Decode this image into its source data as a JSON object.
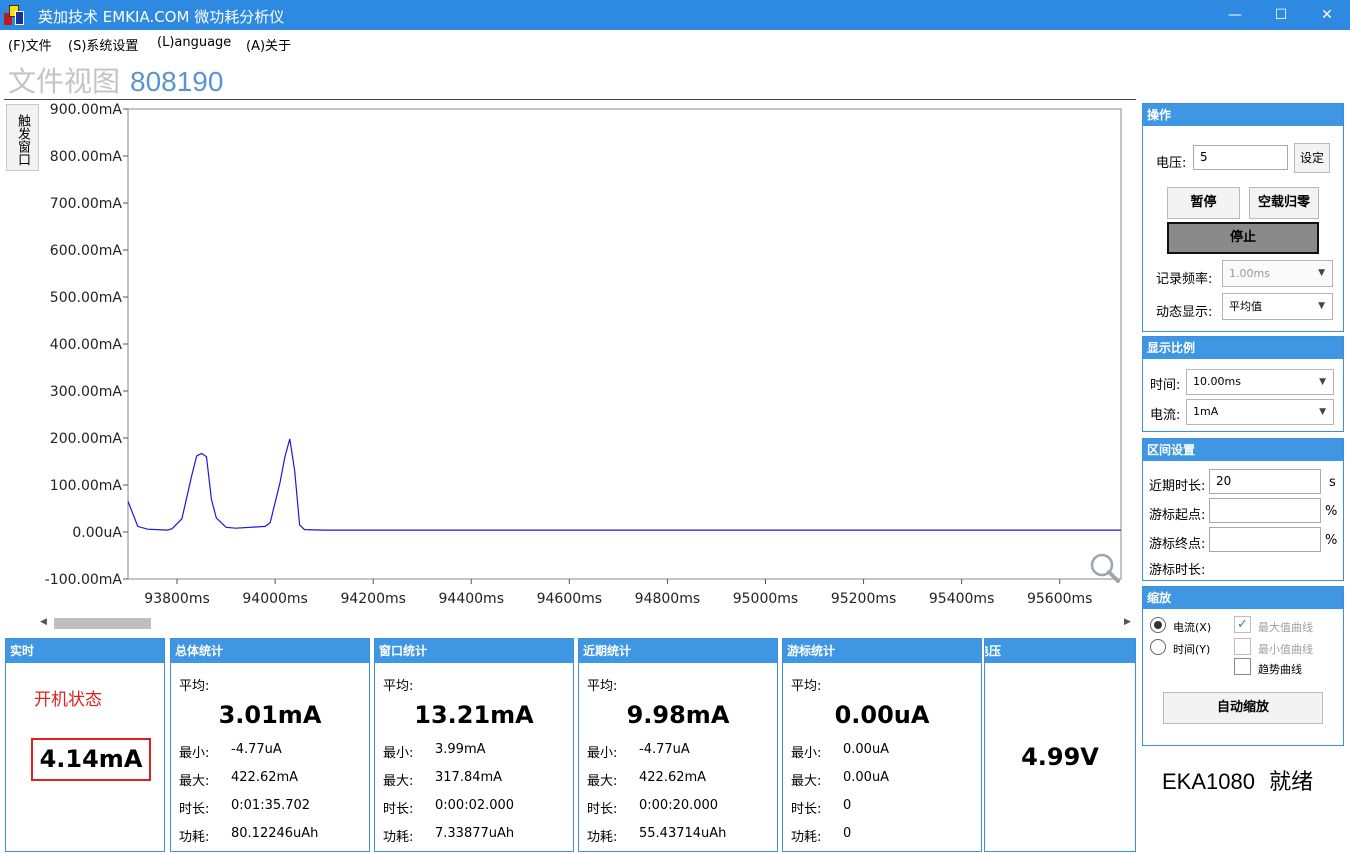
{
  "window": {
    "title": "英加技术 EMKIA.COM 微功耗分析仪",
    "minimize_glyph": "—",
    "maximize_glyph": "☐",
    "close_glyph": "✕",
    "icon": "app-logo-icon",
    "titlebar_color": "#2e8ae0"
  },
  "menu": {
    "file": "(F)文件",
    "settings": "(S)系统设置",
    "language": "(L)anguage",
    "about": "(A)关于"
  },
  "view": {
    "title": "文件视图",
    "number": "808190"
  },
  "trigger_tab": "触发窗口",
  "chart_data": {
    "type": "line",
    "title": "",
    "xlabel": "",
    "ylabel": "",
    "x_unit": "ms",
    "y_unit": "mA",
    "xlim": [
      93700,
      95725
    ],
    "ylim": [
      -100,
      900
    ],
    "yticks": [
      -100,
      0,
      100,
      200,
      300,
      400,
      500,
      600,
      700,
      800,
      900
    ],
    "ytick_labels": [
      "-100.00mA",
      "0.00uA",
      "100.00mA",
      "200.00mA",
      "300.00mA",
      "400.00mA",
      "500.00mA",
      "600.00mA",
      "700.00mA",
      "800.00mA",
      "900.00mA"
    ],
    "xticks": [
      93800,
      94000,
      94200,
      94400,
      94600,
      94800,
      95000,
      95200,
      95400,
      95600
    ],
    "xtick_labels": [
      "93800ms",
      "94000ms",
      "94200ms",
      "94400ms",
      "94600ms",
      "94800ms",
      "95000ms",
      "95200ms",
      "95400ms",
      "95600ms"
    ],
    "grid": false,
    "line_color": "#1a1ad6",
    "series": [
      {
        "x": [
          93700,
          93720,
          93740,
          93780,
          93790,
          93810,
          93830,
          93840,
          93850,
          93860,
          93870,
          93880,
          93900,
          93920,
          93980,
          93990,
          94010,
          94020,
          94030,
          94040,
          94050,
          94060,
          94100,
          95725
        ],
        "y": [
          65,
          12,
          6,
          4,
          7,
          28,
          120,
          162,
          167,
          160,
          70,
          30,
          10,
          8,
          12,
          20,
          105,
          160,
          198,
          130,
          15,
          5,
          4,
          4
        ]
      }
    ]
  },
  "stats": {
    "realtime": {
      "header": "实时",
      "state": "开机状态",
      "value": "4.14mA",
      "state_color": "#e02020"
    },
    "total": {
      "header": "总体统计",
      "avg_label": "平均:",
      "avg": "3.01mA",
      "min_label": "最小:",
      "min": "-4.77uA",
      "max_label": "最大:",
      "max": "422.62mA",
      "dur_label": "时长:",
      "dur": "0:01:35.702",
      "energy_label": "功耗:",
      "energy": "80.12246uAh"
    },
    "window": {
      "header": "窗口统计",
      "avg_label": "平均:",
      "avg": "13.21mA",
      "min_label": "最小:",
      "min": "3.99mA",
      "max_label": "最大:",
      "max": "317.84mA",
      "dur_label": "时长:",
      "dur": "0:00:02.000",
      "energy_label": "功耗:",
      "energy": "7.33877uAh"
    },
    "recent": {
      "header": "近期统计",
      "avg_label": "平均:",
      "avg": "9.98mA",
      "min_label": "最小:",
      "min": "-4.77uA",
      "max_label": "最大:",
      "max": "422.62mA",
      "dur_label": "时长:",
      "dur": "0:00:20.000",
      "energy_label": "功耗:",
      "energy": "55.43714uAh"
    },
    "cursor": {
      "header": "游标统计",
      "avg_label": "平均:",
      "avg": "0.00uA",
      "min_label": "最小:",
      "min": "0.00uA",
      "max_label": "最大:",
      "max": "0.00uA",
      "dur_label": "时长:",
      "dur": "0",
      "energy_label": "功耗:",
      "energy": "0"
    },
    "voltage": {
      "header": "电压",
      "value": "4.99V"
    }
  },
  "ops": {
    "header": "操作",
    "voltage_label": "电压:",
    "voltage_value": "5",
    "set_button": "设定",
    "pause_button": "暂停",
    "zero_button": "空载归零",
    "stop_button": "停止",
    "record_freq_label": "记录频率:",
    "record_freq_value": "1.00ms",
    "display_label": "动态显示:",
    "display_value": "平均值"
  },
  "scale": {
    "header": "显示比例",
    "time_label": "时间:",
    "time_value": "10.00ms",
    "current_label": "电流:",
    "current_value": "1mA"
  },
  "range": {
    "header": "区间设置",
    "recent_label": "近期时长:",
    "recent_value": "20",
    "recent_unit": "s",
    "cursor_start_label": "游标起点:",
    "cursor_start_unit": "%",
    "cursor_end_label": "游标终点:",
    "cursor_end_unit": "%",
    "cursor_dur_label": "游标时长:"
  },
  "zoom": {
    "header": "缩放",
    "current_radio": "电流(X)",
    "time_radio": "时间(Y)",
    "max_curve": "最大值曲线",
    "min_curve": "最小值曲线",
    "trend_curve": "趋势曲线",
    "auto_button": "自动缩放"
  },
  "status": {
    "device": "EKA1080",
    "state": "就绪"
  }
}
